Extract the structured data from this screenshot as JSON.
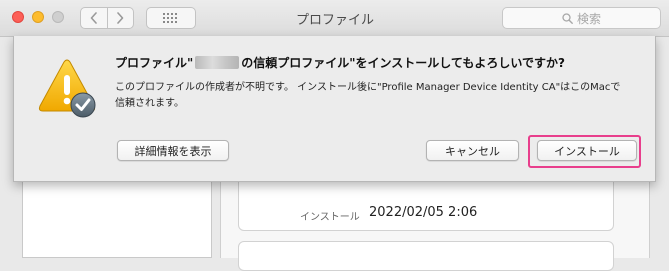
{
  "window": {
    "title": "プロファイル",
    "search_placeholder": "検索"
  },
  "dialog": {
    "title_prefix": "プロファイル\"",
    "title_suffix": "の信頼プロファイル\"をインストールしてもよろしいですか?",
    "message": "このプロファイルの作成者が不明です。 インストール後に\"Profile Manager Device Identity CA\"はこのMacで信頼されます。",
    "buttons": {
      "show_details": "詳細情報を表示",
      "cancel": "キャンセル",
      "install": "インストール"
    }
  },
  "background": {
    "install_label": "インストール",
    "install_date": "2022/02/05 2:06"
  },
  "colors": {
    "highlight": "#e83e8c",
    "close": "#fc5f57",
    "minimize": "#fdbc2e",
    "zoom": "#cfcfcf"
  },
  "icons": [
    "close-traffic-light",
    "minimize-traffic-light",
    "zoom-traffic-light",
    "chevron-left-icon",
    "chevron-right-icon",
    "grid-icon",
    "search-icon",
    "warning-icon",
    "checkmark-badge-icon"
  ]
}
